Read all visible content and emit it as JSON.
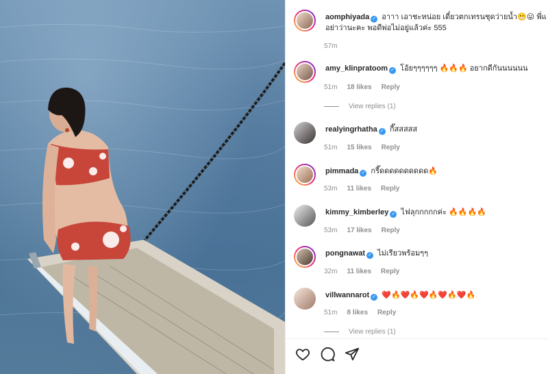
{
  "post": {
    "author": "aomphiyada",
    "caption_line1": "อาาา เอาชะหน่อย เดี๋ยวตกเทรนชุดว่ายน้ำ😬😛 พี่แ",
    "caption_line2": "อย่าว่านะคะ พอดีพ่อไม่อยู่แล้วค่ะ 555",
    "time": "57m"
  },
  "comments": [
    {
      "user": "amy_klinpratoom",
      "verified": true,
      "text": "โอ้ยๆๆๆๆๆๆ 🔥🔥🔥 อยากดีกันนนนนน",
      "time": "51m",
      "likes": "18 likes",
      "reply": "Reply",
      "view_replies": "View replies (1)"
    },
    {
      "user": "realyingrhatha",
      "verified": true,
      "text": "กี๊สสสสส",
      "time": "51m",
      "likes": "15 likes",
      "reply": "Reply"
    },
    {
      "user": "pimmada",
      "verified": true,
      "text": "กรี๊ดดดดดดดดดด🔥",
      "time": "53m",
      "likes": "11 likes",
      "reply": "Reply"
    },
    {
      "user": "kimmy_kimberley",
      "verified": true,
      "text": "ไฟลุกกกกกค่ะ 🔥🔥🔥🔥",
      "time": "53m",
      "likes": "17 likes",
      "reply": "Reply"
    },
    {
      "user": "pongnawat",
      "verified": true,
      "text": "ไม่เรียวพร้อมๆๆ",
      "time": "32m",
      "likes": "11 likes",
      "reply": "Reply"
    },
    {
      "user": "villwannarot",
      "verified": true,
      "text": "❤️🔥❤️🔥❤️🔥❤️🔥❤️🔥",
      "time": "51m",
      "likes": "8 likes",
      "reply": "Reply",
      "view_replies": "View replies (1)"
    }
  ],
  "icons": {
    "like": "heart-icon",
    "comment": "comment-icon",
    "share": "share-icon"
  },
  "colors": {
    "verified": "#3897f0",
    "meta": "#8e8e8e",
    "text": "#262626"
  }
}
